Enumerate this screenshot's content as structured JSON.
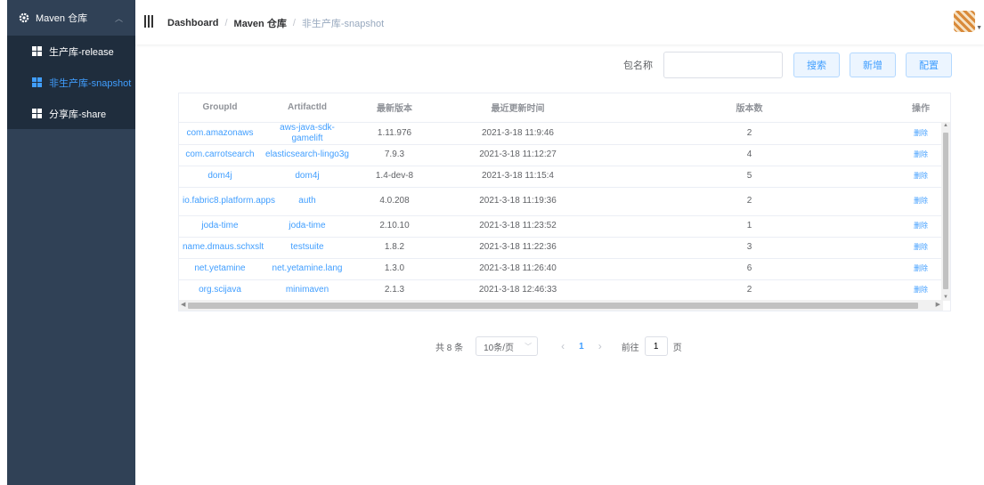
{
  "sidebar": {
    "title": "Maven 仓库",
    "items": [
      {
        "label": "生产库-release",
        "active": false
      },
      {
        "label": "非生产库-snapshot",
        "active": true
      },
      {
        "label": "分享库-share",
        "active": false
      }
    ]
  },
  "breadcrumb": [
    "Dashboard",
    "Maven 仓库",
    "非生产库-snapshot"
  ],
  "search": {
    "label": "包名称",
    "value": "",
    "search_button": "搜索",
    "add_button": "新增",
    "config_button": "配置"
  },
  "table": {
    "headers": [
      "GroupId",
      "ArtifactId",
      "最新版本",
      "最近更新时间",
      "版本数",
      "操作"
    ],
    "rows": [
      {
        "group": "com.amazonaws",
        "artifact": "aws-java-sdk-gamelift",
        "version": "1.11.976",
        "updated": "2021-3-18 11:9:46",
        "count": "2",
        "action": "删除"
      },
      {
        "group": "com.carrotsearch",
        "artifact": "elasticsearch-lingo3g",
        "version": "7.9.3",
        "updated": "2021-3-18 11:12:27",
        "count": "4",
        "action": "删除"
      },
      {
        "group": "dom4j",
        "artifact": "dom4j",
        "version": "1.4-dev-8",
        "updated": "2021-3-18 11:15:4",
        "count": "5",
        "action": "删除"
      },
      {
        "group": "io.fabric8.platform.apps",
        "artifact": "auth",
        "version": "4.0.208",
        "updated": "2021-3-18 11:19:36",
        "count": "2",
        "action": "删除"
      },
      {
        "group": "joda-time",
        "artifact": "joda-time",
        "version": "2.10.10",
        "updated": "2021-3-18 11:23:52",
        "count": "1",
        "action": "删除"
      },
      {
        "group": "name.dmaus.schxslt",
        "artifact": "testsuite",
        "version": "1.8.2",
        "updated": "2021-3-18 11:22:36",
        "count": "3",
        "action": "删除"
      },
      {
        "group": "net.yetamine",
        "artifact": "net.yetamine.lang",
        "version": "1.3.0",
        "updated": "2021-3-18 11:26:40",
        "count": "6",
        "action": "删除"
      },
      {
        "group": "org.scijava",
        "artifact": "minimaven",
        "version": "2.1.3",
        "updated": "2021-3-18 12:46:33",
        "count": "2",
        "action": "删除"
      }
    ]
  },
  "pagination": {
    "total": "共 8 条",
    "page_size": "10条/页",
    "current_page": "1",
    "goto_label": "前往",
    "goto_value": "1",
    "page_suffix": "页"
  },
  "colors": {
    "sidebar_bg": "#304156",
    "submenu_bg": "#1f2d3d",
    "accent": "#409eff"
  }
}
